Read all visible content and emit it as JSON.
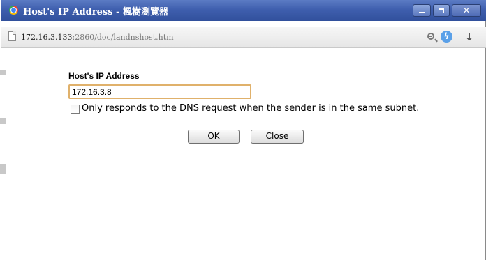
{
  "window": {
    "title": "Host's IP Address - 楓樹瀏覽器",
    "url_host": "172.16.3.133",
    "url_path": ":2860/doc/landnshost.htm"
  },
  "form": {
    "label": "Host's IP Address",
    "ip_value": "172.16.3.8",
    "checkbox_checked": false,
    "checkbox_label": "Only responds to the DNS request when the sender is in the same subnet.",
    "ok_label": "OK",
    "close_label": "Close"
  },
  "icons": [
    "browser-logo-icon",
    "minimize-icon",
    "maximize-icon",
    "close-icon",
    "page-icon",
    "zoom-icon",
    "bolt-icon",
    "download-icon"
  ],
  "colors": {
    "titlebar": "#3f5fae",
    "input_border": "#e0b16b"
  }
}
